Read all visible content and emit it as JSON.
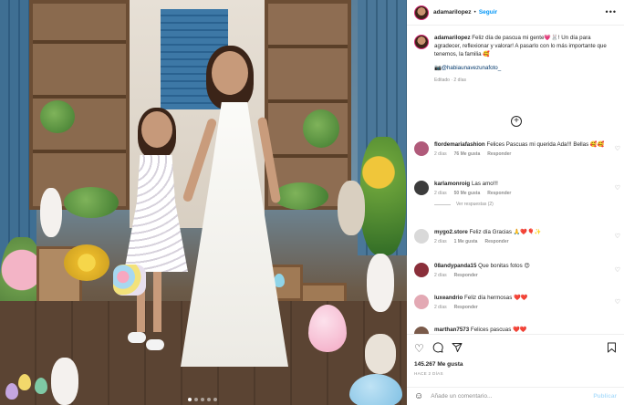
{
  "post": {
    "username": "adamarilopez",
    "separator": "•",
    "follow_label": "Seguir",
    "more_label": "•••"
  },
  "caption": {
    "username": "adamarilopez",
    "text": "Feliz día de pascua mi gente💗🐰! Un día para agradecer, reflexionar y valorar! A pasarlo con lo más importante que tenemos, la familia 🥰",
    "mention": "📷@habiaunavezunafoto_",
    "edited": "Editado · 2 días"
  },
  "load_more_label": "+",
  "comments": [
    {
      "username": "flordemariafashion",
      "text": "Felices Pascuas mi querida Ada!!! Bellas 🥰🥰",
      "age": "2 días",
      "likes": "76 Me gusta",
      "reply": "Responder",
      "avatar_color": "#b05a7a"
    },
    {
      "username": "karlamonroig",
      "text": "Las amo!!!",
      "age": "2 días",
      "likes": "50 Me gusta",
      "reply": "Responder",
      "replies": "Ver respuestas (2)",
      "avatar_color": "#3c3c3c"
    },
    {
      "username": "mygo2.store",
      "text": "Feliz día Gracias 🙏❤️🎈✨",
      "age": "2 días",
      "likes": "1 Me gusta",
      "reply": "Responder",
      "avatar_color": "#d9d9d9"
    },
    {
      "username": "08andypanda15",
      "text": "Que bonitas fotos 😍",
      "age": "2 días",
      "likes": "",
      "reply": "Responder",
      "avatar_color": "#8a2f3a"
    },
    {
      "username": "luxeandrio",
      "text": "Feliz día hermosas ❤️❤️",
      "age": "2 días",
      "likes": "",
      "reply": "Responder",
      "avatar_color": "#e3a9b4"
    },
    {
      "username": "marthan7573",
      "text": "Felices pascuas ❤️❤️",
      "age": "",
      "likes": "",
      "reply": "",
      "avatar_color": "#7a5a4a"
    }
  ],
  "actions": {
    "likes_count": "145.267",
    "likes_word": "Me gusta",
    "date": "HACE 2 DÍAS"
  },
  "add_comment": {
    "placeholder": "Añade un comentario...",
    "post_label": "Publicar"
  },
  "icons": {
    "heart": "heart-icon",
    "comment": "comment-icon",
    "share": "share-icon",
    "bookmark": "bookmark-icon",
    "emoji": "emoji-icon",
    "more": "more-options-icon"
  },
  "colors": {
    "accent": "#0095f6",
    "post_disabled": "#b2dffc",
    "text": "#262626",
    "muted": "#8e8e8e"
  }
}
